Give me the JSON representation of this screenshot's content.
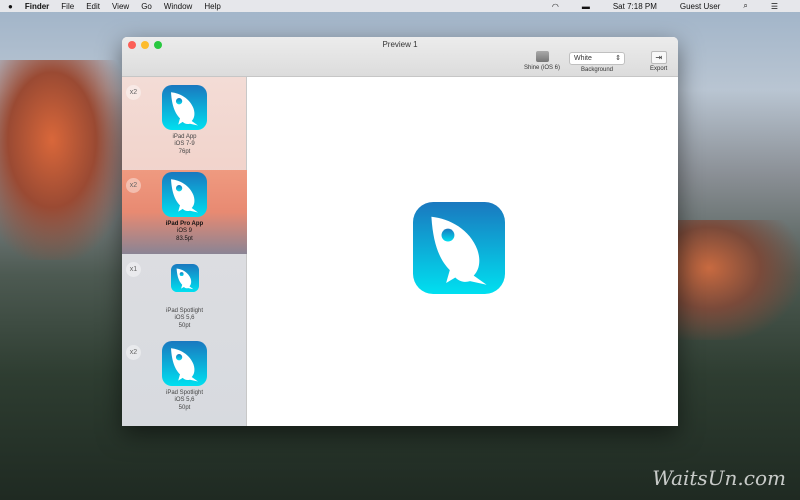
{
  "menubar": {
    "apple": "",
    "app": "Finder",
    "items": [
      "File",
      "Edit",
      "View",
      "Go",
      "Window",
      "Help"
    ],
    "clock": "Sat 7:18 PM",
    "user": "Guest User"
  },
  "window": {
    "title": "Preview 1",
    "toolbar": {
      "shine_label": "Shine (iOS 6)",
      "background_value": "White",
      "background_label": "Background",
      "export_label": "Export"
    }
  },
  "sidebar": {
    "items": [
      {
        "scale": "x2",
        "name": "iPad App",
        "ios": "iOS 7-9",
        "size": "76pt"
      },
      {
        "scale": "x2",
        "name": "iPad Pro App",
        "ios": "iOS 9",
        "size": "83.5pt",
        "selected": true
      },
      {
        "scale": "x1",
        "name": "iPad Spotlight",
        "ios": "iOS 5,6",
        "size": "50pt"
      },
      {
        "scale": "x2",
        "name": "iPad Spotlight",
        "ios": "iOS 5,6",
        "size": "50pt"
      }
    ]
  },
  "colors": {
    "icon_top": "#1a78bf",
    "icon_bottom": "#00e0f0",
    "selected": "#e88a72"
  },
  "watermark": "WaitsUn.com"
}
